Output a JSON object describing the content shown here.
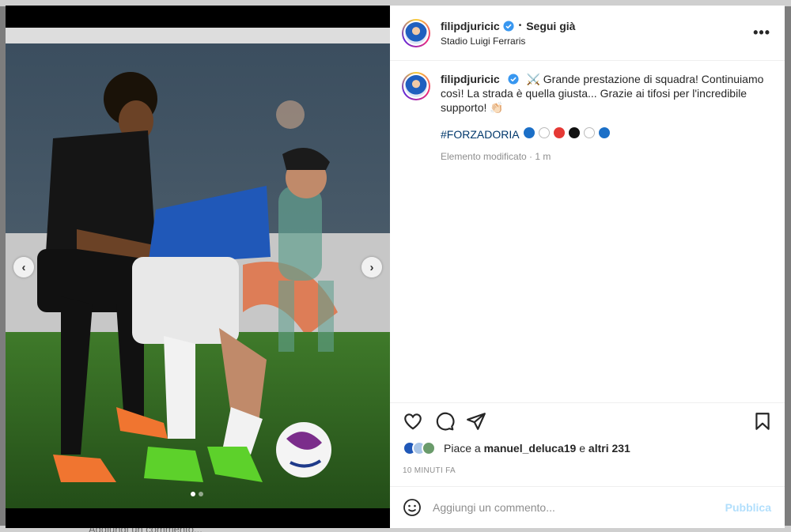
{
  "background": {
    "ghost_comment": "Aggiungi un commento..."
  },
  "post": {
    "username": "filipdjuricic",
    "follow_label": "Segui già",
    "separator": "•",
    "location": "Stadio Luigi Ferraris",
    "more_label": "•••",
    "caption": {
      "text": "⚔️ Grande prestazione di squadra! Continuiamo così! La strada è quella giusta... Grazie ai tifosi per l'incredibile supporto! 👏🏻",
      "hashtag": "#FORZADORIA",
      "circles": [
        "#1b6fc7",
        "#ffffff",
        "#e53935",
        "#111111",
        "#ffffff",
        "#1b6fc7"
      ],
      "edited": "Elemento modificato · 1 m"
    },
    "likes": {
      "prefix": "Piace a",
      "user": "manuel_deluca19",
      "conj": "e",
      "others": "altri 231"
    },
    "timestamp": "10 MINUTI FA",
    "comment_placeholder": "Aggiungi un commento...",
    "publish_label": "Pubblica"
  },
  "carousel": {
    "prev_label": "‹",
    "next_label": "›",
    "slides": 2,
    "active_slide": 1
  },
  "colors": {
    "verified": "#3897f0",
    "hashtag": "#00376b",
    "publish_disabled": "#b2dffc"
  },
  "icons": [
    "heart-icon",
    "comment-icon",
    "share-icon",
    "bookmark-icon",
    "emoji-icon",
    "verified-icon"
  ]
}
